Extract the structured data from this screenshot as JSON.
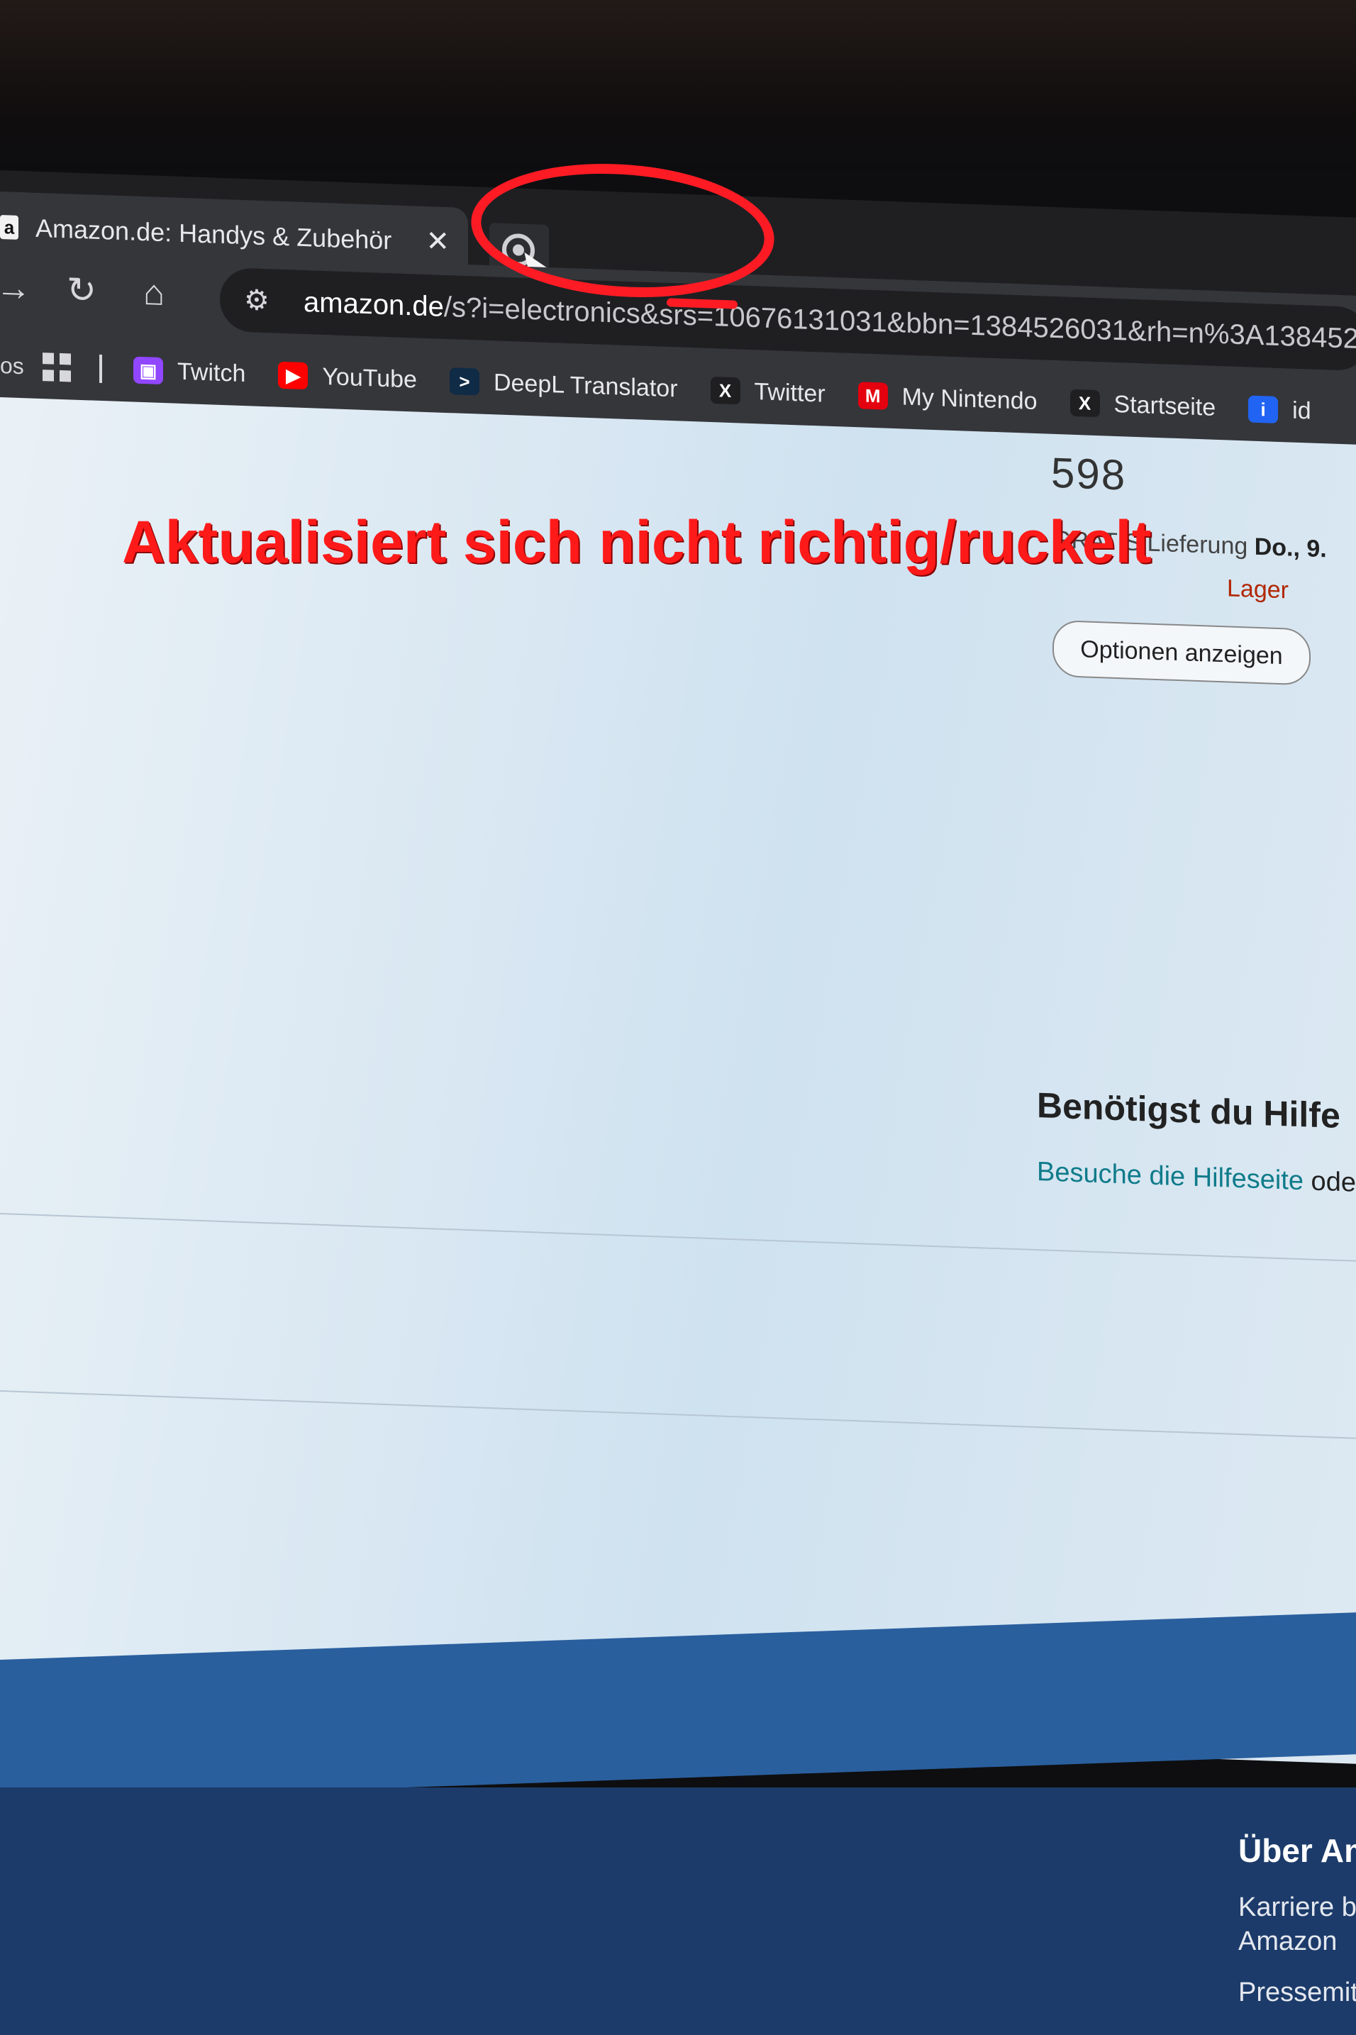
{
  "browser": {
    "tab": {
      "title": "Amazon.de: Handys & Zubehör",
      "favicon": "a",
      "close_glyph": "✕"
    },
    "omnibox": {
      "url_host": "amazon.de",
      "url_path": "/s?i=electronics&srs=10676131031&bbn=1384526031&rh=n%3A138452"
    },
    "bookmarks_edge_label": "os",
    "bookmarks": [
      {
        "label": "Twitch",
        "icon": "twitch-icon",
        "color": "#9146ff",
        "glyph": "▣"
      },
      {
        "label": "YouTube",
        "icon": "youtube-icon",
        "color": "#ff0000",
        "glyph": "▶"
      },
      {
        "label": "DeepL Translator",
        "icon": "deepl-icon",
        "color": "#0f2b46",
        "glyph": ">"
      },
      {
        "label": "Twitter",
        "icon": "x-icon",
        "color": "#1f1f22",
        "glyph": "X"
      },
      {
        "label": "My Nintendo",
        "icon": "mario-icon",
        "color": "#e4000f",
        "glyph": "M"
      },
      {
        "label": "Startseite",
        "icon": "x-icon",
        "color": "#1f1f22",
        "glyph": "X"
      },
      {
        "label": "id",
        "icon": "indeed-icon",
        "color": "#2164f3",
        "glyph": "i"
      }
    ]
  },
  "page": {
    "price": "598",
    "delivery_prefix": "GRATIS Lieferung ",
    "delivery_date": "Do., 9.",
    "stock": "Lager",
    "options_button": "Optionen anzeigen",
    "help_title": "Benötigst du Hilfe",
    "help_link": "Besuche die Hilfeseite",
    "help_rest": " ode"
  },
  "annotation": {
    "text": "Aktualisiert sich nicht richtig/ruckelt",
    "color": "#ff1a1a"
  },
  "footer": {
    "title": "Über Am",
    "links": [
      "Karriere b",
      "Amazon",
      "Pressemit"
    ]
  }
}
